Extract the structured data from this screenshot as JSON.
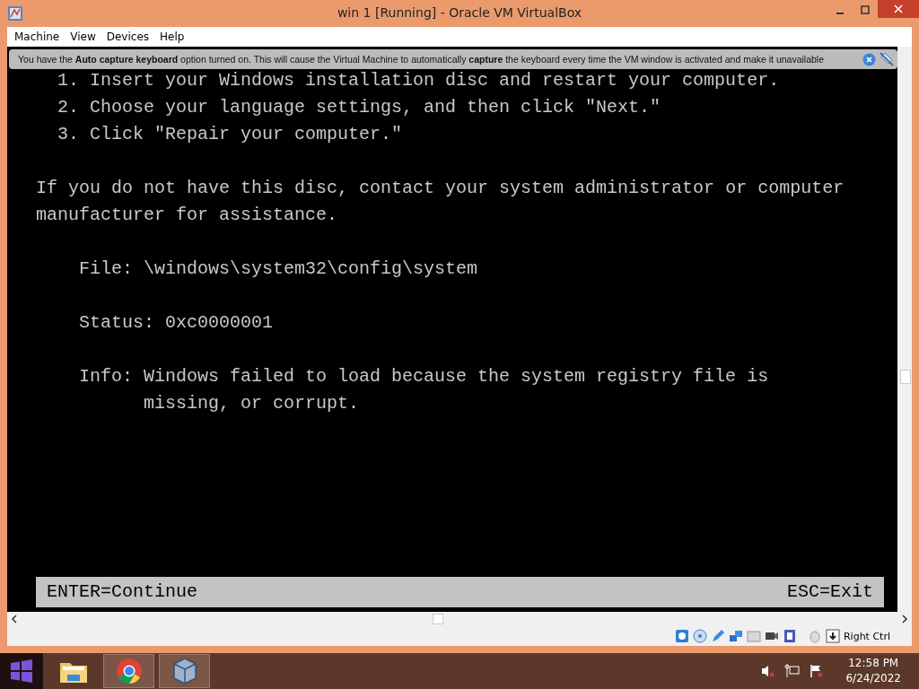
{
  "window": {
    "title": "win 1 [Running] - Oracle VM VirtualBox"
  },
  "menu": [
    "Machine",
    "View",
    "Devices",
    "Help"
  ],
  "notification": {
    "text": "You have the **Auto capture keyboard** option turned on. This will cause the Virtual Machine to automatically **capture** the keyboard every time the VM window is activated and make it unavailable"
  },
  "console": {
    "steps": [
      "1. Insert your Windows installation disc and restart your computer.",
      "2. Choose your language settings, and then click \"Next.\"",
      "3. Click \"Repair your computer.\""
    ],
    "paragraph": "If you do not have this disc, contact your system administrator or computer manufacturer for assistance.",
    "fields": [
      {
        "label": "File:",
        "value": "\\windows\\system32\\config\\system"
      },
      {
        "label": "Status:",
        "value": "0xc0000001"
      },
      {
        "label": "Info:",
        "value": "Windows failed to load because the system registry file is missing, or corrupt."
      }
    ],
    "footer": {
      "left": "ENTER=Continue",
      "right": "ESC=Exit"
    }
  },
  "status_bar": {
    "host_key": "Right Ctrl"
  },
  "taskbar": {
    "apps": [
      {
        "kind": "folder",
        "running": false
      },
      {
        "kind": "chrome",
        "running": true
      },
      {
        "kind": "virtualbox",
        "running": true
      }
    ],
    "time": "12:58 PM",
    "date": "6/24/2022"
  }
}
